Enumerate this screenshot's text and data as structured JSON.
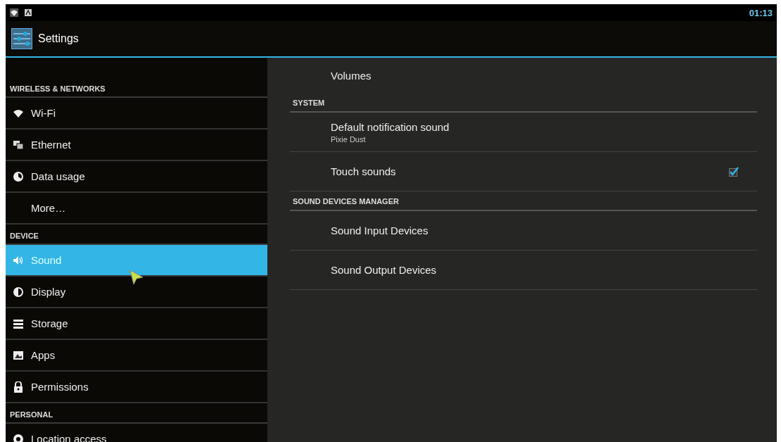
{
  "status_bar": {
    "time": "01:13"
  },
  "action_bar": {
    "title": "Settings"
  },
  "sidebar": {
    "items": [
      {
        "kind": "header",
        "label": "WIRELESS & NETWORKS"
      },
      {
        "kind": "item",
        "label": "Wi-Fi",
        "selected": false
      },
      {
        "kind": "item",
        "label": "Ethernet",
        "selected": false
      },
      {
        "kind": "item",
        "label": "Data usage",
        "selected": false
      },
      {
        "kind": "item",
        "label": "More…",
        "selected": false
      },
      {
        "kind": "header",
        "label": "DEVICE"
      },
      {
        "kind": "item",
        "label": "Sound",
        "selected": true
      },
      {
        "kind": "item",
        "label": "Display",
        "selected": false
      },
      {
        "kind": "item",
        "label": "Storage",
        "selected": false
      },
      {
        "kind": "item",
        "label": "Apps",
        "selected": false
      },
      {
        "kind": "item",
        "label": "Permissions",
        "selected": false
      },
      {
        "kind": "header",
        "label": "PERSONAL"
      },
      {
        "kind": "item",
        "label": "Location access",
        "selected": false
      }
    ]
  },
  "detail": {
    "items": [
      {
        "kind": "item",
        "title": "Volumes"
      },
      {
        "kind": "header",
        "title": "SYSTEM"
      },
      {
        "kind": "item",
        "title": "Default notification sound",
        "summary": "Pixie Dust"
      },
      {
        "kind": "checkbox",
        "title": "Touch sounds",
        "checked": true
      },
      {
        "kind": "header",
        "title": "SOUND DEVICES MANAGER"
      },
      {
        "kind": "item",
        "title": "Sound Input Devices"
      },
      {
        "kind": "item",
        "title": "Sound Output Devices"
      }
    ]
  }
}
